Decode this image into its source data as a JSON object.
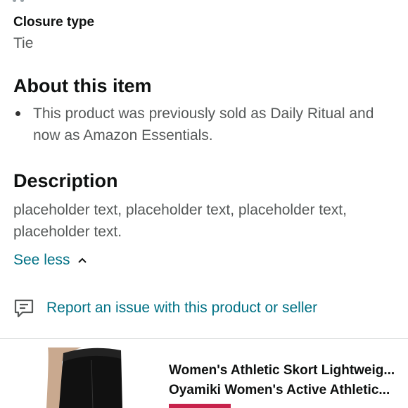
{
  "specs": {
    "closure_label": "Closure type",
    "closure_value": "Tie"
  },
  "about": {
    "heading": "About this item",
    "bullets": [
      "This product was previously sold as Daily Ritual and now as Amazon Essentials."
    ]
  },
  "description": {
    "heading": "Description",
    "text": "placeholder text, placeholder text, placeholder text, placeholder text.",
    "toggle_label": "See less",
    "toggle_icon": "chevron-up-icon"
  },
  "report": {
    "icon": "feedback-icon",
    "label": "Report an issue with this product or seller"
  },
  "related": {
    "items": [
      {
        "title": "Women's Athletic Skort Lightweig..."
      },
      {
        "title": "Oyamiki Women's Active Athletic..."
      }
    ]
  },
  "colors": {
    "link": "#007185",
    "heading": "#0f1111",
    "body_text": "#565959",
    "badge": "#c7224b"
  }
}
